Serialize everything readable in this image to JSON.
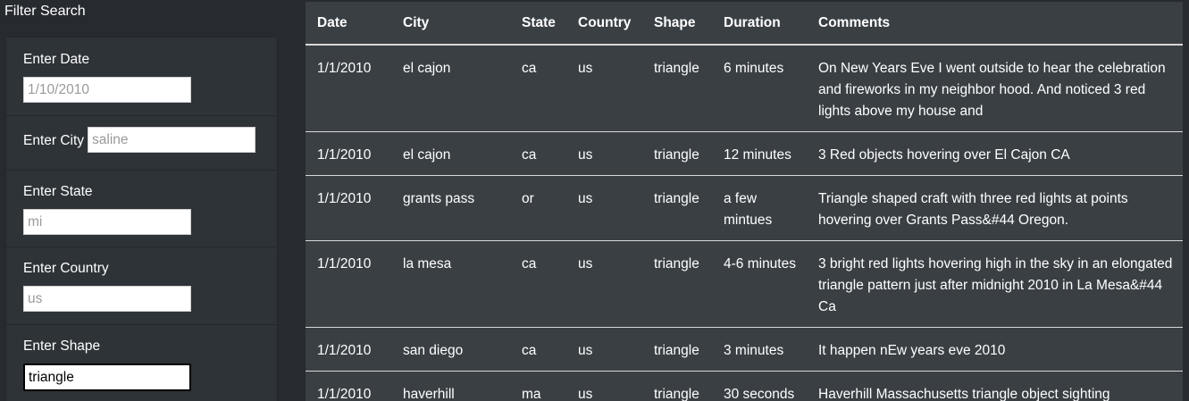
{
  "filter": {
    "title": "Filter Search",
    "fields": [
      {
        "label": "Enter Date",
        "placeholder": "1/10/2010",
        "value": ""
      },
      {
        "label": "Enter City",
        "placeholder": "saline",
        "value": ""
      },
      {
        "label": "Enter State",
        "placeholder": "mi",
        "value": ""
      },
      {
        "label": "Enter Country",
        "placeholder": "us",
        "value": ""
      },
      {
        "label": "Enter Shape",
        "placeholder": "",
        "value": "triangle"
      }
    ]
  },
  "table": {
    "headers": [
      "Date",
      "City",
      "State",
      "Country",
      "Shape",
      "Duration",
      "Comments"
    ],
    "rows": [
      [
        "1/1/2010",
        "el cajon",
        "ca",
        "us",
        "triangle",
        "6 minutes",
        "On New Years Eve I went outside to hear the celebration and fireworks in my neighbor hood. And noticed 3 red lights above my house and"
      ],
      [
        "1/1/2010",
        "el cajon",
        "ca",
        "us",
        "triangle",
        "12 minutes",
        "3 Red objects hovering over El Cajon CA"
      ],
      [
        "1/1/2010",
        "grants pass",
        "or",
        "us",
        "triangle",
        "a few mintues",
        "Triangle shaped craft with three red lights at points hovering over Grants Pass&#44 Oregon."
      ],
      [
        "1/1/2010",
        "la mesa",
        "ca",
        "us",
        "triangle",
        "4-6 minutes",
        "3 bright red lights hovering high in the sky in an elongated triangle pattern just after midnight 2010 in La Mesa&#44 Ca"
      ],
      [
        "1/1/2010",
        "san diego",
        "ca",
        "us",
        "triangle",
        "3 minutes",
        "It happen nEw years eve 2010"
      ],
      [
        "1/1/2010",
        "haverhill",
        "ma",
        "us",
        "triangle",
        "30 seconds",
        "Haverhill Massachusetts triangle object sighting"
      ]
    ]
  }
}
